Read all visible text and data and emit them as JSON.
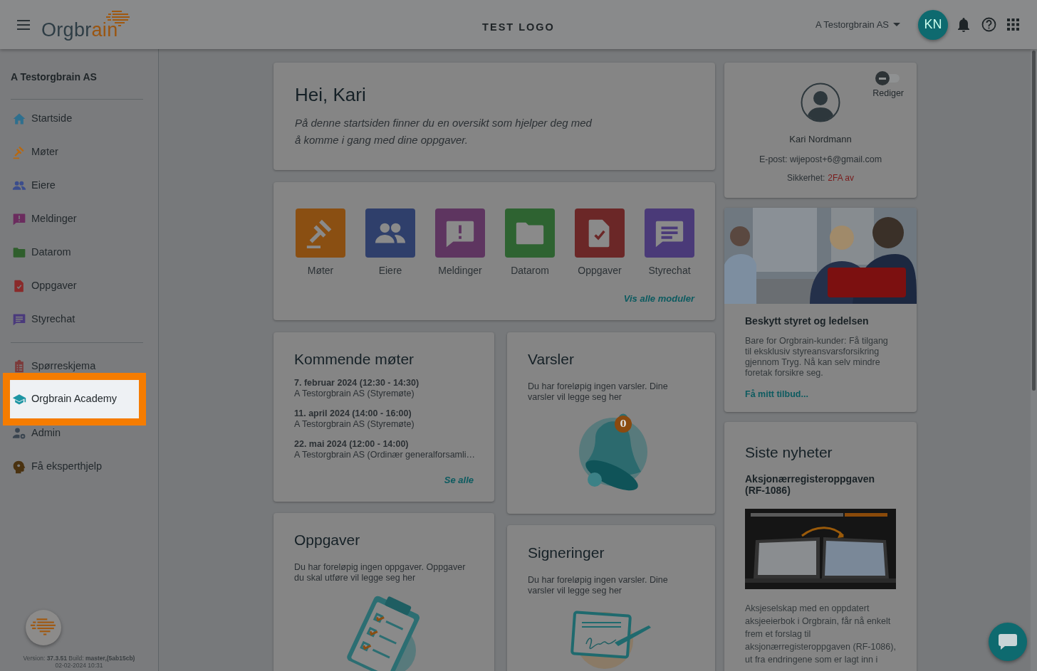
{
  "header": {
    "logo": [
      {
        "text": "Orgbr",
        "accent": false
      },
      {
        "text": "ain",
        "accent": true
      }
    ],
    "center_title": "TEST LOGO",
    "org_switcher": "A Testorgbrain AS",
    "avatar": "KN"
  },
  "sidebar": {
    "org": "A Testorgbrain AS",
    "groups": [
      [
        {
          "label": "Startside",
          "kind": "home",
          "highlighted": false
        },
        {
          "label": "Møter",
          "kind": "gavel",
          "highlighted": false
        },
        {
          "label": "Eiere",
          "kind": "people",
          "highlighted": false
        },
        {
          "label": "Meldinger",
          "kind": "message",
          "highlighted": false
        },
        {
          "label": "Datarom",
          "kind": "folder",
          "highlighted": false
        },
        {
          "label": "Oppgaver",
          "kind": "document",
          "highlighted": false
        },
        {
          "label": "Styrechat",
          "kind": "chat",
          "highlighted": false
        }
      ],
      [
        {
          "label": "Spørreskjema",
          "kind": "form",
          "highlighted": false
        },
        {
          "label": "Orgbrain Academy",
          "kind": "academy",
          "highlighted": true
        },
        {
          "label": "Admin",
          "kind": "admin",
          "highlighted": false
        },
        {
          "label": "Få eksperthjelp",
          "kind": "expert",
          "highlighted": false
        }
      ]
    ],
    "version": "Version: **37.3.51** Build: **master,(5ab15cb)**",
    "build_date": "02-02-2024 10:31"
  },
  "welcome": {
    "title": "Hei, Kari",
    "text": "På denne startsiden finner du en oversikt som hjelper deg med å komme i gang med dine oppgaver."
  },
  "modules": {
    "items": [
      {
        "label": "Møter",
        "kind": "gavel"
      },
      {
        "label": "Eiere",
        "kind": "people"
      },
      {
        "label": "Meldinger",
        "kind": "message"
      },
      {
        "label": "Datarom",
        "kind": "folder"
      },
      {
        "label": "Oppgaver",
        "kind": "document"
      },
      {
        "label": "Styrechat",
        "kind": "chat"
      }
    ],
    "link": "Vis alle moduler"
  },
  "meetings": {
    "title": "Kommende møter",
    "items": [
      {
        "date": "7. februar 2024 (12:30 - 14:30)",
        "description": "A Testorgbrain AS (Styremøte)"
      },
      {
        "date": "11. april 2024 (14:00 - 16:00)",
        "description": "A Testorgbrain AS (Styremøte)"
      },
      {
        "date": "22. mai 2024 (12:00 - 14:00)",
        "description": "A Testorgbrain AS (Ordinær generalforsamli…"
      }
    ],
    "link": "Se alle"
  },
  "alerts": {
    "title": "Varsler",
    "text": "Du har foreløpig ingen varsler. Dine varsler vil legge seg her",
    "count": "0"
  },
  "tasks": {
    "title": "Oppgaver",
    "text": "Du har foreløpig ingen oppgaver. Oppgaver du skal utføre vil legge seg her"
  },
  "signatures": {
    "title": "Signeringer",
    "text": "Du har foreløpig ingen varsler. Dine varsler vil legge seg her"
  },
  "profile": {
    "edit_toggle": {
      "label": "Rediger",
      "on": false
    },
    "name": "Kari Nordmann",
    "email": "E-post: wijepost+6@gmail.com",
    "security": {
      "label": "Sikkerhet:",
      "value": "2FA av",
      "enabled": false
    }
  },
  "promo": {
    "title": "Beskytt styret og ledelsen",
    "text": "Bare for Orgbrain-kunder: Få tilgang til eksklusiv styreansvarsforsikring gjennom Tryg. Nå kan selv mindre foretak forsikre seg.",
    "link": "Få mitt tilbud..."
  },
  "news": {
    "title": "Siste nyheter",
    "article_title": "Aksjonærregisteroppgaven (RF-1086)",
    "text": "Aksjeselskap med en oppdatert aksjeeierbok i Orgbrain, får nå enkelt frem et forslag til aksjonærregisteroppgaven (RF-1086), ut fra endringene som er lagt inn i"
  }
}
